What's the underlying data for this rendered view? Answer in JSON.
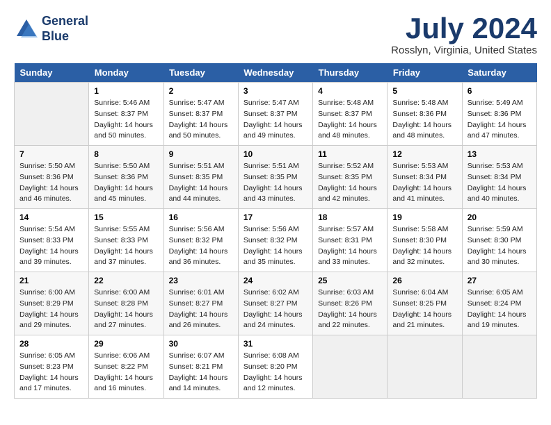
{
  "logo": {
    "line1": "General",
    "line2": "Blue"
  },
  "title": "July 2024",
  "location": "Rosslyn, Virginia, United States",
  "days_of_week": [
    "Sunday",
    "Monday",
    "Tuesday",
    "Wednesday",
    "Thursday",
    "Friday",
    "Saturday"
  ],
  "weeks": [
    [
      {
        "num": "",
        "detail": ""
      },
      {
        "num": "1",
        "detail": "Sunrise: 5:46 AM\nSunset: 8:37 PM\nDaylight: 14 hours\nand 50 minutes."
      },
      {
        "num": "2",
        "detail": "Sunrise: 5:47 AM\nSunset: 8:37 PM\nDaylight: 14 hours\nand 50 minutes."
      },
      {
        "num": "3",
        "detail": "Sunrise: 5:47 AM\nSunset: 8:37 PM\nDaylight: 14 hours\nand 49 minutes."
      },
      {
        "num": "4",
        "detail": "Sunrise: 5:48 AM\nSunset: 8:37 PM\nDaylight: 14 hours\nand 48 minutes."
      },
      {
        "num": "5",
        "detail": "Sunrise: 5:48 AM\nSunset: 8:36 PM\nDaylight: 14 hours\nand 48 minutes."
      },
      {
        "num": "6",
        "detail": "Sunrise: 5:49 AM\nSunset: 8:36 PM\nDaylight: 14 hours\nand 47 minutes."
      }
    ],
    [
      {
        "num": "7",
        "detail": "Sunrise: 5:50 AM\nSunset: 8:36 PM\nDaylight: 14 hours\nand 46 minutes."
      },
      {
        "num": "8",
        "detail": "Sunrise: 5:50 AM\nSunset: 8:36 PM\nDaylight: 14 hours\nand 45 minutes."
      },
      {
        "num": "9",
        "detail": "Sunrise: 5:51 AM\nSunset: 8:35 PM\nDaylight: 14 hours\nand 44 minutes."
      },
      {
        "num": "10",
        "detail": "Sunrise: 5:51 AM\nSunset: 8:35 PM\nDaylight: 14 hours\nand 43 minutes."
      },
      {
        "num": "11",
        "detail": "Sunrise: 5:52 AM\nSunset: 8:35 PM\nDaylight: 14 hours\nand 42 minutes."
      },
      {
        "num": "12",
        "detail": "Sunrise: 5:53 AM\nSunset: 8:34 PM\nDaylight: 14 hours\nand 41 minutes."
      },
      {
        "num": "13",
        "detail": "Sunrise: 5:53 AM\nSunset: 8:34 PM\nDaylight: 14 hours\nand 40 minutes."
      }
    ],
    [
      {
        "num": "14",
        "detail": "Sunrise: 5:54 AM\nSunset: 8:33 PM\nDaylight: 14 hours\nand 39 minutes."
      },
      {
        "num": "15",
        "detail": "Sunrise: 5:55 AM\nSunset: 8:33 PM\nDaylight: 14 hours\nand 37 minutes."
      },
      {
        "num": "16",
        "detail": "Sunrise: 5:56 AM\nSunset: 8:32 PM\nDaylight: 14 hours\nand 36 minutes."
      },
      {
        "num": "17",
        "detail": "Sunrise: 5:56 AM\nSunset: 8:32 PM\nDaylight: 14 hours\nand 35 minutes."
      },
      {
        "num": "18",
        "detail": "Sunrise: 5:57 AM\nSunset: 8:31 PM\nDaylight: 14 hours\nand 33 minutes."
      },
      {
        "num": "19",
        "detail": "Sunrise: 5:58 AM\nSunset: 8:30 PM\nDaylight: 14 hours\nand 32 minutes."
      },
      {
        "num": "20",
        "detail": "Sunrise: 5:59 AM\nSunset: 8:30 PM\nDaylight: 14 hours\nand 30 minutes."
      }
    ],
    [
      {
        "num": "21",
        "detail": "Sunrise: 6:00 AM\nSunset: 8:29 PM\nDaylight: 14 hours\nand 29 minutes."
      },
      {
        "num": "22",
        "detail": "Sunrise: 6:00 AM\nSunset: 8:28 PM\nDaylight: 14 hours\nand 27 minutes."
      },
      {
        "num": "23",
        "detail": "Sunrise: 6:01 AM\nSunset: 8:27 PM\nDaylight: 14 hours\nand 26 minutes."
      },
      {
        "num": "24",
        "detail": "Sunrise: 6:02 AM\nSunset: 8:27 PM\nDaylight: 14 hours\nand 24 minutes."
      },
      {
        "num": "25",
        "detail": "Sunrise: 6:03 AM\nSunset: 8:26 PM\nDaylight: 14 hours\nand 22 minutes."
      },
      {
        "num": "26",
        "detail": "Sunrise: 6:04 AM\nSunset: 8:25 PM\nDaylight: 14 hours\nand 21 minutes."
      },
      {
        "num": "27",
        "detail": "Sunrise: 6:05 AM\nSunset: 8:24 PM\nDaylight: 14 hours\nand 19 minutes."
      }
    ],
    [
      {
        "num": "28",
        "detail": "Sunrise: 6:05 AM\nSunset: 8:23 PM\nDaylight: 14 hours\nand 17 minutes."
      },
      {
        "num": "29",
        "detail": "Sunrise: 6:06 AM\nSunset: 8:22 PM\nDaylight: 14 hours\nand 16 minutes."
      },
      {
        "num": "30",
        "detail": "Sunrise: 6:07 AM\nSunset: 8:21 PM\nDaylight: 14 hours\nand 14 minutes."
      },
      {
        "num": "31",
        "detail": "Sunrise: 6:08 AM\nSunset: 8:20 PM\nDaylight: 14 hours\nand 12 minutes."
      },
      {
        "num": "",
        "detail": ""
      },
      {
        "num": "",
        "detail": ""
      },
      {
        "num": "",
        "detail": ""
      }
    ]
  ]
}
